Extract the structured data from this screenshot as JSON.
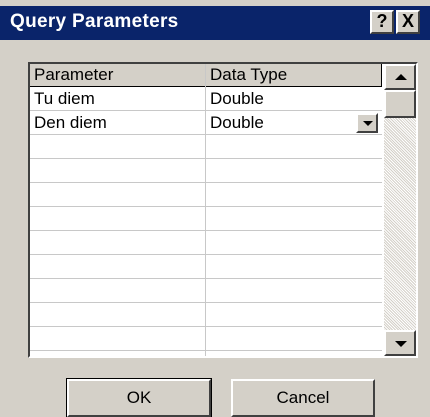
{
  "dialog": {
    "title": "Query Parameters",
    "help_button": "?",
    "close_button": "X"
  },
  "grid": {
    "columns": [
      "Parameter",
      "Data Type"
    ],
    "rows": [
      {
        "parameter": "Tu diem",
        "data_type": "Double"
      },
      {
        "parameter": "Den diem",
        "data_type": "Double"
      }
    ]
  },
  "buttons": {
    "ok": "OK",
    "cancel": "Cancel"
  }
}
